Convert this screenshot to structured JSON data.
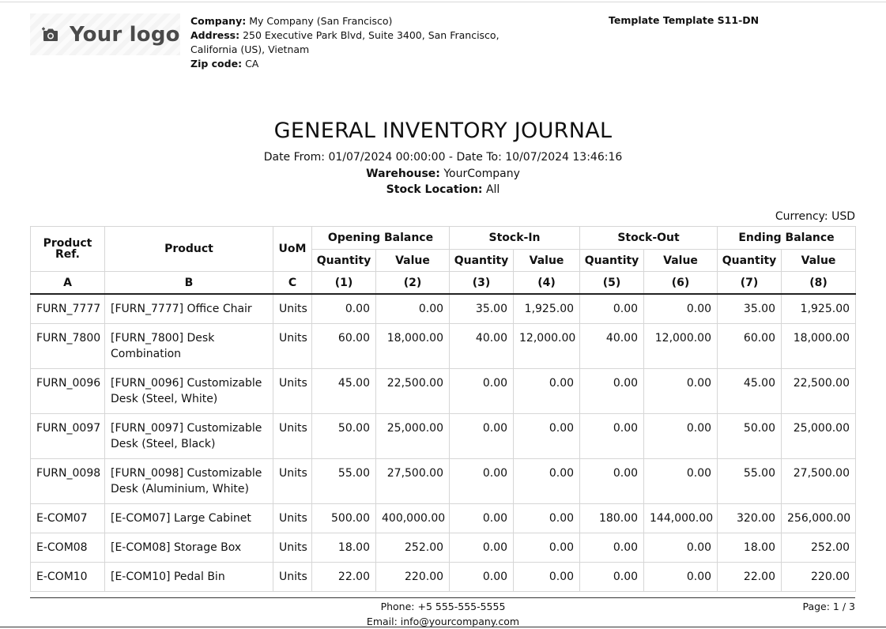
{
  "logo": {
    "text": "Your logo",
    "icon": "camera-icon"
  },
  "company": {
    "company_label": "Company:",
    "company_value": "My Company (San Francisco)",
    "address_label": "Address:",
    "address_line1": "250 Executive Park Blvd, Suite 3400, San Francisco,",
    "address_line2": "California (US), Vietnam",
    "zip_label": "Zip code:",
    "zip_value": "CA"
  },
  "template": "Template Template S11-DN",
  "title": "GENERAL INVENTORY JOURNAL",
  "date_range": "Date From: 01/07/2024 00:00:00 - Date To: 10/07/2024 13:46:16",
  "warehouse": {
    "label": "Warehouse:",
    "value": "YourCompany"
  },
  "location": {
    "label": "Stock Location:",
    "value": "All"
  },
  "currency": "Currency: USD",
  "table": {
    "headers": {
      "ref": "Product Ref.",
      "product": "Product",
      "uom": "UoM",
      "opening": "Opening Balance",
      "stock_in": "Stock-In",
      "stock_out": "Stock-Out",
      "ending": "Ending Balance",
      "quantity": "Quantity",
      "value": "Value",
      "codes": [
        "A",
        "B",
        "C",
        "(1)",
        "(2)",
        "(3)",
        "(4)",
        "(5)",
        "(6)",
        "(7)",
        "(8)"
      ]
    },
    "rows": [
      {
        "ref": "FURN_7777",
        "product": "[FURN_7777] Office Chair",
        "uom": "Units",
        "o_qty": "0.00",
        "o_val": "0.00",
        "i_qty": "35.00",
        "i_val": "1,925.00",
        "x_qty": "0.00",
        "x_val": "0.00",
        "e_qty": "35.00",
        "e_val": "1,925.00"
      },
      {
        "ref": "FURN_7800",
        "product": "[FURN_7800] Desk Combination",
        "uom": "Units",
        "o_qty": "60.00",
        "o_val": "18,000.00",
        "i_qty": "40.00",
        "i_val": "12,000.00",
        "x_qty": "40.00",
        "x_val": "12,000.00",
        "e_qty": "60.00",
        "e_val": "18,000.00"
      },
      {
        "ref": "FURN_0096",
        "product": "[FURN_0096] Customizable Desk (Steel, White)",
        "uom": "Units",
        "o_qty": "45.00",
        "o_val": "22,500.00",
        "i_qty": "0.00",
        "i_val": "0.00",
        "x_qty": "0.00",
        "x_val": "0.00",
        "e_qty": "45.00",
        "e_val": "22,500.00"
      },
      {
        "ref": "FURN_0097",
        "product": "[FURN_0097] Customizable Desk (Steel, Black)",
        "uom": "Units",
        "o_qty": "50.00",
        "o_val": "25,000.00",
        "i_qty": "0.00",
        "i_val": "0.00",
        "x_qty": "0.00",
        "x_val": "0.00",
        "e_qty": "50.00",
        "e_val": "25,000.00"
      },
      {
        "ref": "FURN_0098",
        "product": "[FURN_0098] Customizable Desk (Aluminium, White)",
        "uom": "Units",
        "o_qty": "55.00",
        "o_val": "27,500.00",
        "i_qty": "0.00",
        "i_val": "0.00",
        "x_qty": "0.00",
        "x_val": "0.00",
        "e_qty": "55.00",
        "e_val": "27,500.00"
      },
      {
        "ref": "E-COM07",
        "product": "[E-COM07] Large Cabinet",
        "uom": "Units",
        "o_qty": "500.00",
        "o_val": "400,000.00",
        "i_qty": "0.00",
        "i_val": "0.00",
        "x_qty": "180.00",
        "x_val": "144,000.00",
        "e_qty": "320.00",
        "e_val": "256,000.00"
      },
      {
        "ref": "E-COM08",
        "product": "[E-COM08] Storage Box",
        "uom": "Units",
        "o_qty": "18.00",
        "o_val": "252.00",
        "i_qty": "0.00",
        "i_val": "0.00",
        "x_qty": "0.00",
        "x_val": "0.00",
        "e_qty": "18.00",
        "e_val": "252.00"
      },
      {
        "ref": "E-COM10",
        "product": "[E-COM10] Pedal Bin",
        "uom": "Units",
        "o_qty": "22.00",
        "o_val": "220.00",
        "i_qty": "0.00",
        "i_val": "0.00",
        "x_qty": "0.00",
        "x_val": "0.00",
        "e_qty": "22.00",
        "e_val": "220.00"
      }
    ]
  },
  "footer": {
    "phone": "Phone: +5 555-555-5555",
    "email": "Email: info@yourcompany.com",
    "page": "Page: 1 / 3"
  }
}
